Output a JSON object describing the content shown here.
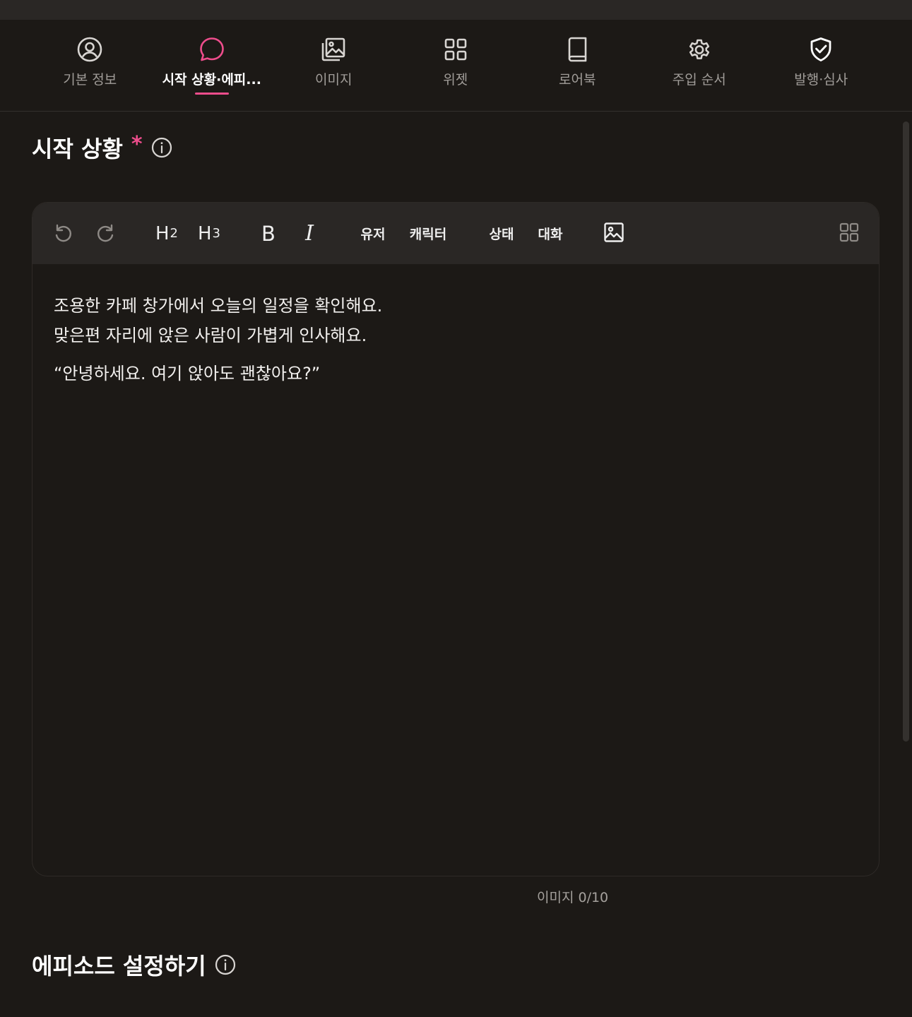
{
  "tabs": [
    {
      "label": "기본 정보",
      "icon": "user-circle-icon",
      "active": false
    },
    {
      "label": "시작 상황·에피...",
      "icon": "chat-bubble-icon",
      "active": true
    },
    {
      "label": "이미지",
      "icon": "image-stack-icon",
      "active": false
    },
    {
      "label": "위젯",
      "icon": "grid-icon",
      "active": false
    },
    {
      "label": "로어북",
      "icon": "book-icon",
      "active": false
    },
    {
      "label": "주입 순서",
      "icon": "gear-icon",
      "active": false
    },
    {
      "label": "발행·심사",
      "icon": "shield-check-icon",
      "active": false
    }
  ],
  "section": {
    "title": "시작 상황",
    "required_mark": "*"
  },
  "toolbar": {
    "h2": "H",
    "h2_sub": "2",
    "h3": "H",
    "h3_sub": "3",
    "bold": "B",
    "italic": "I",
    "user": "유저",
    "character": "캐릭터",
    "status": "상태",
    "dialogue": "대화"
  },
  "editor": {
    "line1": "조용한 카페 창가에서 오늘의 일정을 확인해요.",
    "line2": "맞은편 자리에 앉은 사람이 가볍게 인사해요.",
    "line3": "“안녕하세요. 여기 앉아도 괜찮아요?”"
  },
  "image_counter": "이미지 0/10",
  "episode_section": {
    "title": "에피소드 설정하기"
  },
  "colors": {
    "accent": "#ee4d8c",
    "background": "#1c1916",
    "toolbar": "#2a2725"
  }
}
